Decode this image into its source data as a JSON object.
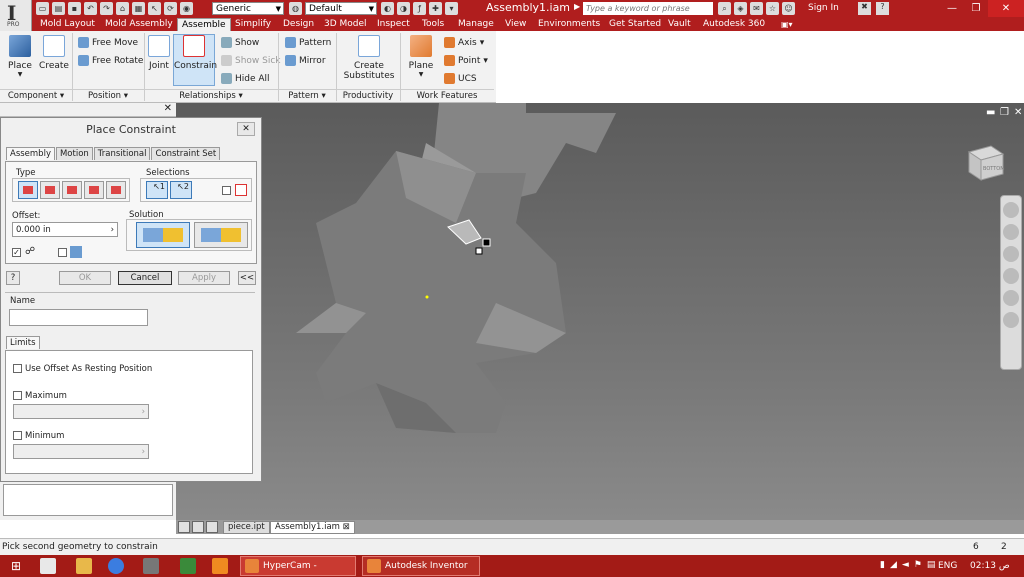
{
  "app": {
    "logo_letter": "I",
    "logo_sub": "PRO",
    "window_title": "Assembly1.iam",
    "material_combo": "Generic",
    "appearance_combo": "Default",
    "search_placeholder": "Type a keyword or phrase",
    "sign_in": "Sign In"
  },
  "menu_tabs": [
    "Mold Layout",
    "Mold Assembly",
    "Assemble",
    "Simplify",
    "Design",
    "3D Model",
    "Inspect",
    "Tools",
    "Manage",
    "View",
    "Environments",
    "Get Started",
    "Vault",
    "Autodesk 360"
  ],
  "active_menu_tab": "Assemble",
  "ribbon": {
    "component": {
      "label": "Component",
      "place": "Place",
      "create": "Create"
    },
    "position": {
      "label": "Position",
      "free_move": "Free Move",
      "free_rotate": "Free Rotate"
    },
    "relationships": {
      "label": "Relationships",
      "joint": "Joint",
      "constrain": "Constrain",
      "show": "Show",
      "show_sick": "Show Sick",
      "hide_all": "Hide All"
    },
    "pattern": {
      "label": "Pattern",
      "pattern": "Pattern",
      "mirror": "Mirror"
    },
    "productivity": {
      "label": "Productivity",
      "create_substitutes_1": "Create",
      "create_substitutes_2": "Substitutes"
    },
    "work_features": {
      "label": "Work Features",
      "plane": "Plane",
      "axis": "Axis",
      "point": "Point",
      "ucs": "UCS"
    }
  },
  "dialog": {
    "title": "Place Constraint",
    "tabs": [
      "Assembly",
      "Motion",
      "Transitional",
      "Constraint Set"
    ],
    "type_label": "Type",
    "selections_label": "Selections",
    "sel1": "1",
    "sel2": "2",
    "offset_label": "Offset:",
    "offset_value": "0.000 in",
    "solution_label": "Solution",
    "ok": "OK",
    "cancel": "Cancel",
    "apply": "Apply",
    "expand": "<<",
    "help": "?",
    "name_label": "Name",
    "name_value": "",
    "limits_tab": "Limits",
    "use_offset": "Use Offset As Resting Position",
    "maximum": "Maximum",
    "minimum": "Minimum"
  },
  "viewcube_label": "BOTTOM",
  "doc_tabs": [
    "piece.ipt",
    "Assembly1.iam"
  ],
  "active_doc_tab": "Assembly1.iam",
  "status": {
    "message": "Pick second geometry to constrain",
    "count1": "6",
    "count2": "2"
  },
  "taskbar": {
    "tasks": [
      "HyperCam - Recordi...",
      "Autodesk Inventor Pr..."
    ],
    "lang": "ENG",
    "time": "02:13 ص"
  }
}
